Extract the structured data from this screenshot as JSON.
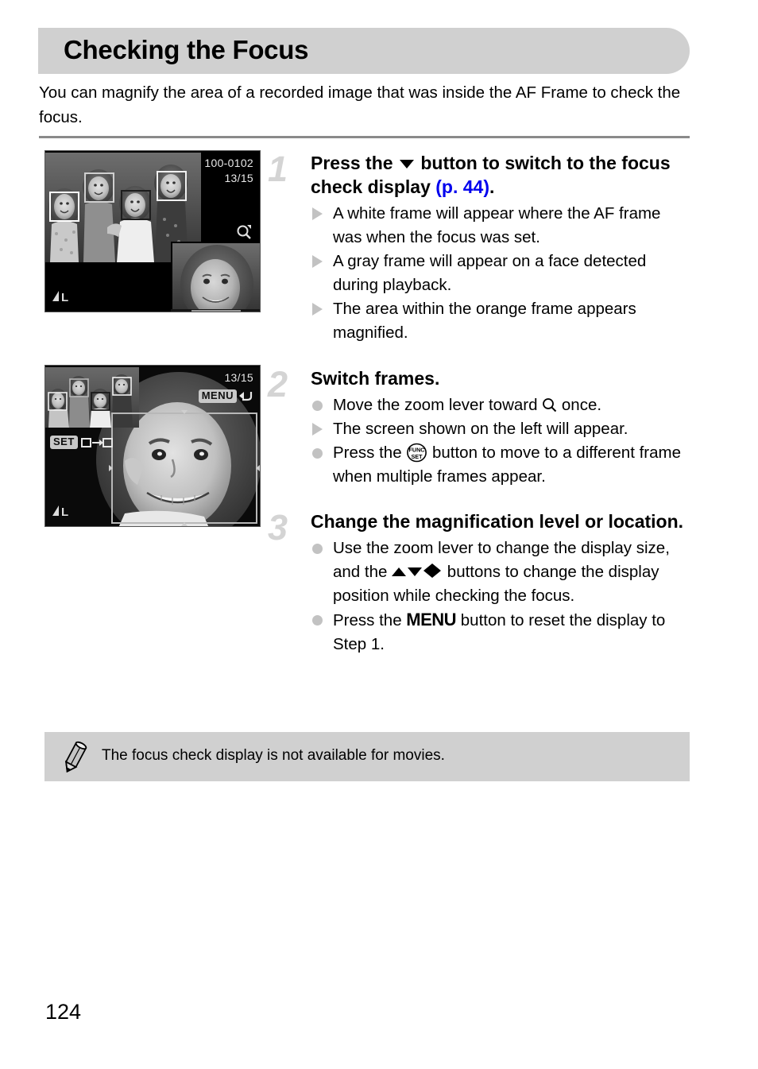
{
  "header": {
    "title": "Checking the Focus"
  },
  "intro": {
    "text": "You can magnify the area of a recorded image that was inside the AF Frame to check the focus."
  },
  "screens": [
    {
      "name": "focus-check-display",
      "file_number": "100-0102",
      "frame_counter": "13/15",
      "magnify_icon": "magnifier-icon",
      "quality_indicator": "◤L"
    },
    {
      "name": "magnified-focus-check-display",
      "frame_counter": "13/15",
      "menu_badge": "MENU",
      "menu_arrow": "return-arrow-icon",
      "set_badge": "SET",
      "set_icon": "frame-switch-icon",
      "quality_indicator": "◤L"
    }
  ],
  "steps": [
    {
      "number": "1",
      "heading_before_icon": "Press the ",
      "heading_icon": "down-arrow-button-icon",
      "heading_after_icon": " button to switch to the focus check display ",
      "heading_link": "(p. 44)",
      "heading_end": ".",
      "bullets": [
        {
          "marker": "triangle",
          "text": "A white frame will appear where the AF frame was when the focus was set."
        },
        {
          "marker": "triangle",
          "text": "A gray frame will appear on a face detected during playback."
        },
        {
          "marker": "triangle",
          "text": "The area within the orange frame appears magnified."
        }
      ]
    },
    {
      "number": "2",
      "heading": "Switch frames.",
      "bullets": [
        {
          "marker": "dot",
          "text_before": "Move the zoom lever toward ",
          "icon": "magnifier-icon",
          "text_after": " once."
        },
        {
          "marker": "triangle",
          "text": "The screen shown on the left will appear."
        },
        {
          "marker": "dot",
          "text_before": "Press the ",
          "icon": "func-set-button-icon",
          "text_after": " button to move to a different frame when multiple frames appear."
        }
      ]
    },
    {
      "number": "3",
      "heading": "Change the magnification level or location.",
      "bullets": [
        {
          "marker": "dot",
          "text_before": "Use the zoom lever to change the display size, and the ",
          "icon": "direction-buttons-icon",
          "text_after": " buttons to change the display position while checking the focus."
        },
        {
          "marker": "dot",
          "text_before": "Press the ",
          "icon": "menu-button-icon",
          "icon_label": "MENU",
          "text_after": " button to reset the display to Step 1."
        }
      ]
    }
  ],
  "note": {
    "icon": "pencil-icon",
    "text": "The focus check display is not available for movies."
  },
  "footer": {
    "page_number": "124"
  },
  "colors": {
    "header_background": "#d0d0d0",
    "note_background": "#d0d0d0",
    "link": "#0000ee",
    "step_number": "#d4d4d4",
    "marker": "#c2c2c2",
    "rule": "#8a8a8a"
  }
}
